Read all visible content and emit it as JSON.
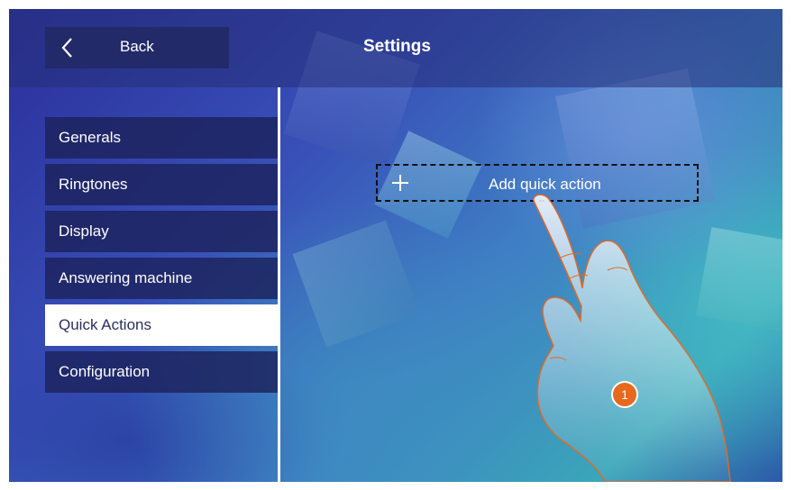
{
  "header": {
    "back_label": "Back",
    "title": "Settings"
  },
  "menu": {
    "items": [
      {
        "label": "Generals",
        "active": false
      },
      {
        "label": "Ringtones",
        "active": false
      },
      {
        "label": "Display",
        "active": false
      },
      {
        "label": "Answering machine",
        "active": false
      },
      {
        "label": "Quick Actions",
        "active": true
      },
      {
        "label": "Configuration",
        "active": false
      }
    ]
  },
  "content": {
    "add_quick_action_label": "Add quick action"
  },
  "annotation": {
    "step_number": "1"
  },
  "icons": {
    "back": "chevron-left-icon",
    "add": "plus-icon",
    "hand": "pointing-hand-icon"
  },
  "colors": {
    "header_bg": "#263078",
    "button_bg": "#222a6a",
    "menu_bg": "#1c225c",
    "active_menu_bg": "#ffffff",
    "active_menu_text": "#2a2f5e",
    "badge": "#e8681e",
    "hand_outline": "#e8681e"
  }
}
